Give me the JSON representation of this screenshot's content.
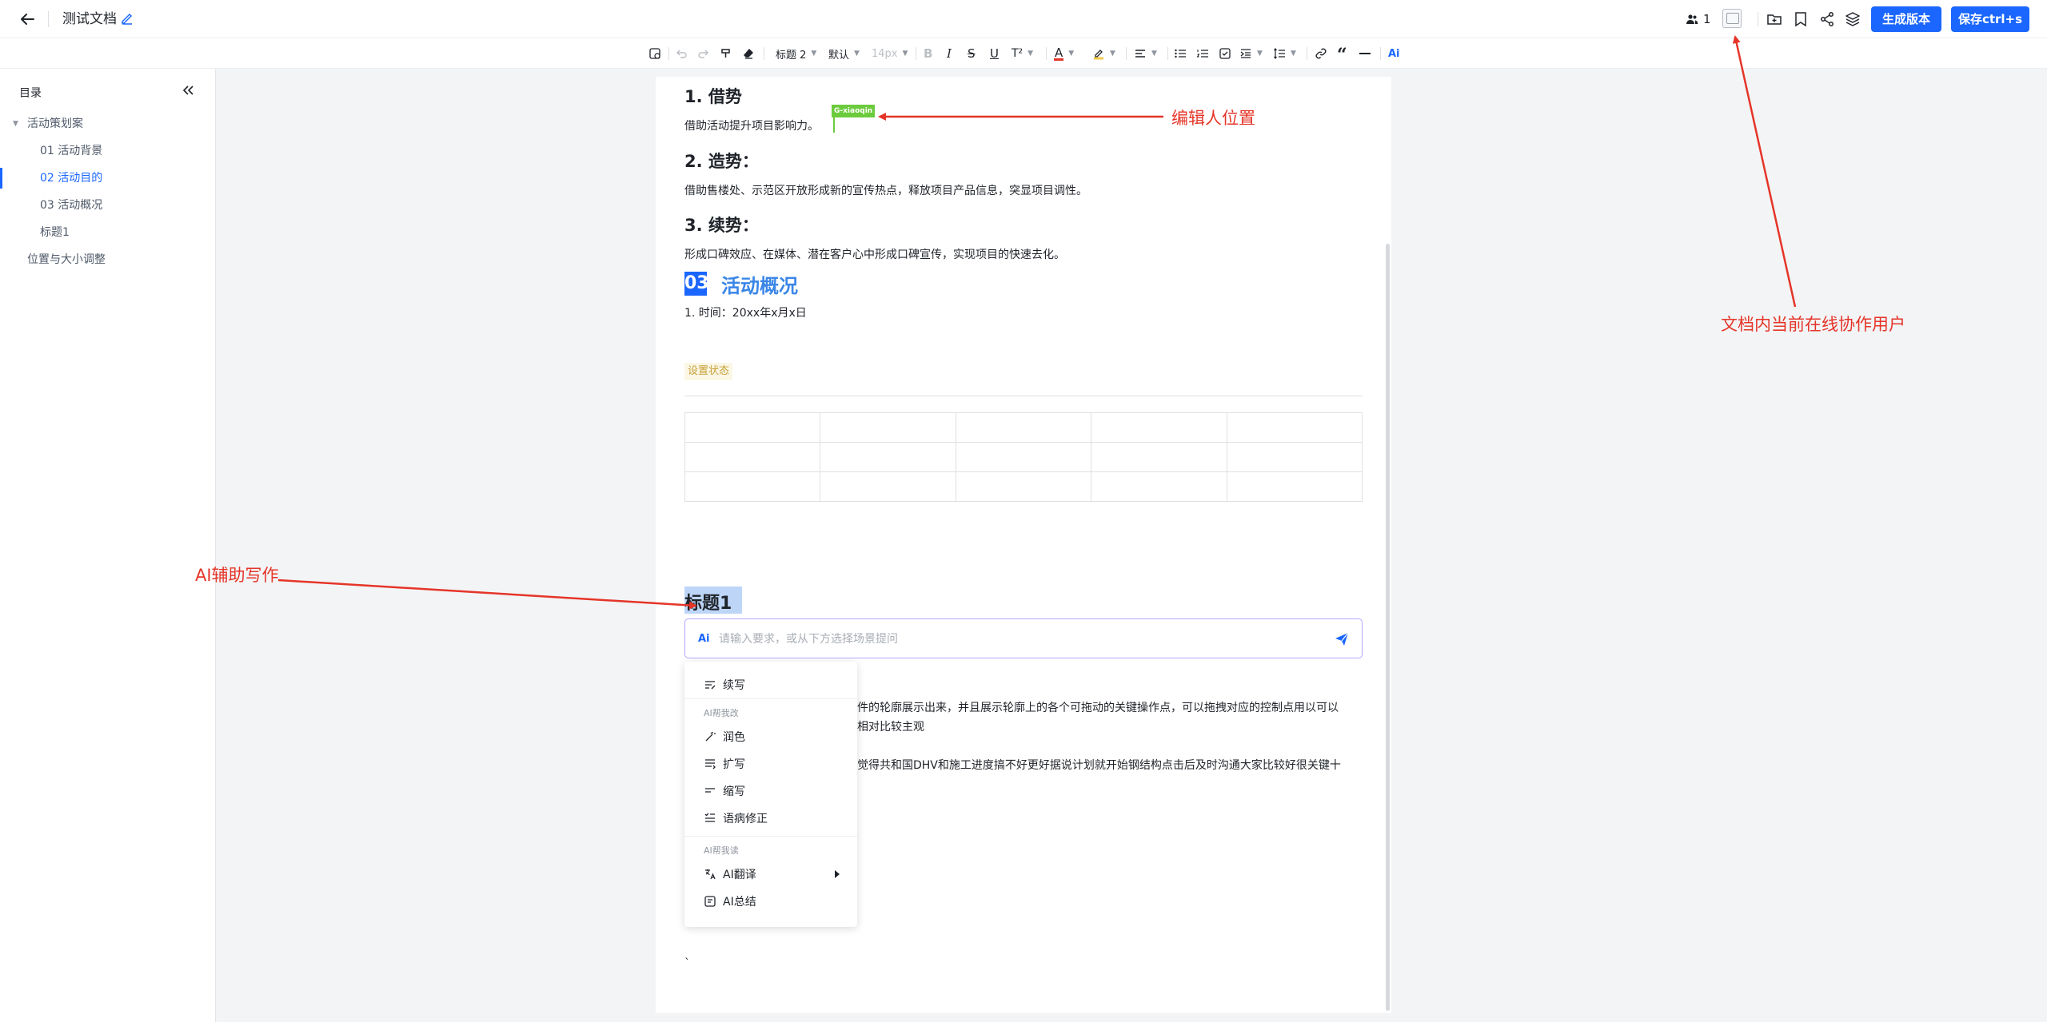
{
  "header": {
    "doc_title": "测试文档",
    "online_count": "1",
    "generate_version_label": "生成版本",
    "save_label": "保存ctrl+s"
  },
  "toolbar": {
    "block_style": "标题 2",
    "font_family": "默认",
    "font_size": "14px"
  },
  "sidebar": {
    "title": "目录",
    "items": [
      {
        "label": "活动策划案"
      },
      {
        "label": "01  活动背景"
      },
      {
        "label": "02  活动目的"
      },
      {
        "label": "03  活动概况"
      },
      {
        "label": "标题1"
      },
      {
        "label": "位置与大小调整"
      }
    ]
  },
  "document": {
    "sections": [
      {
        "heading": "1. 借势",
        "text": "借助活动提升项目影响力。"
      },
      {
        "heading": "2. 造势：",
        "text": "借助售楼处、示范区开放形成新的宣传热点，释放项目产品信息，突显项目调性。"
      },
      {
        "heading": "3. 续势：",
        "text": "形成口碑效应、在媒体、潜在客户心中形成口碑宣传，实现项目的快速去化。"
      }
    ],
    "collaborator_name": "G-xiaoqin",
    "section_num": "03",
    "section_title": "活动概况",
    "time_line": "1. 时间：20xx年x月x日",
    "status_tag": "设置状态",
    "heading1": "标题1",
    "body_line1_a": "件的轮廓展示出来，并且展示轮廓上的各个可拖动的关键操作点，可以拖拽对应的控制点用以可以",
    "body_line1_b": "相对比较主观",
    "body_line2": "觉得共和国DHV和施工进度搞不好更好据说计划就开始钢结构点击后及时沟通大家比较好很关键十",
    "stray_char": "`"
  },
  "ai": {
    "logo": "Ai",
    "placeholder": "请输入要求，或从下方选择场景提问",
    "menu": {
      "continue": "续写",
      "group_modify": "AI帮我改",
      "polish": "润色",
      "expand": "扩写",
      "shorten": "缩写",
      "grammar": "语病修正",
      "group_read": "AI帮我读",
      "translate": "AI翻译",
      "summary": "AI总结"
    }
  },
  "annotations": {
    "editor_position": "编辑人位置",
    "online_users": "文档内当前在线协作用户",
    "ai_writing": "AI辅助写作"
  },
  "colors": {
    "primary": "#1a66ff",
    "annotation": "#e53528",
    "collaborator": "#6ccb3c"
  }
}
